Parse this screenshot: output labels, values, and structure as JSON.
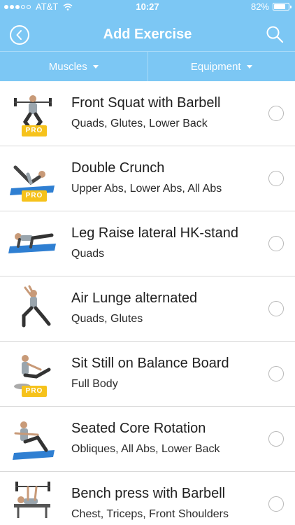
{
  "status": {
    "carrier": "AT&T",
    "time": "10:27",
    "battery_percent": "82%",
    "battery_level": 0.82,
    "signal_bars_filled": 3,
    "signal_bars_total": 5
  },
  "nav": {
    "title": "Add Exercise",
    "back_icon": "back-chevron-icon",
    "search_icon": "search-icon"
  },
  "filters": [
    {
      "label": "Muscles"
    },
    {
      "label": "Equipment"
    }
  ],
  "pro_label": "PRO",
  "exercises": [
    {
      "name": "Front Squat with Barbell",
      "muscles": "Quads, Glutes, Lower Back",
      "pro": true
    },
    {
      "name": "Double Crunch",
      "muscles": "Upper Abs, Lower Abs, All Abs",
      "pro": true
    },
    {
      "name": "Leg Raise lateral HK-stand",
      "muscles": "Quads",
      "pro": false
    },
    {
      "name": "Air Lunge alternated",
      "muscles": "Quads, Glutes",
      "pro": false
    },
    {
      "name": "Sit Still on Balance Board",
      "muscles": "Full Body",
      "pro": true
    },
    {
      "name": "Seated Core Rotation",
      "muscles": "Obliques, All Abs, Lower Back",
      "pro": false
    },
    {
      "name": "Bench press with Barbell",
      "muscles": "Chest, Triceps, Front Shoulders",
      "pro": false
    }
  ],
  "colors": {
    "header_bg": "#7cc7f4",
    "pro_badge": "#f6c21b",
    "mat_blue": "#2f7fd2"
  }
}
